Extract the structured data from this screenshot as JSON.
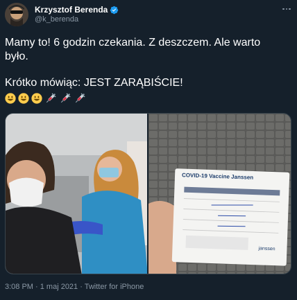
{
  "author": {
    "display_name": "Krzysztof Berenda",
    "handle": "@k_berenda"
  },
  "tweet": {
    "line1": "Mamy to! 6 godzin czekania. Z deszczem. Ale warto",
    "line2": "było.",
    "line3": "Krótko mówiąc: JEST ZARĄBIŚCIE!",
    "emojis": [
      "smiley",
      "smiley",
      "smiley",
      "syringe",
      "syringe",
      "syringe"
    ]
  },
  "media": {
    "card_title": "COVID-19 Vaccine Janssen"
  },
  "meta": {
    "timestamp": "3:08 PM · 1 maj 2021 · Twitter for iPhone"
  },
  "colors": {
    "background": "#15202b",
    "secondary_text": "#8b98a5",
    "verified": "#1d9bf0",
    "border": "#38444d"
  }
}
